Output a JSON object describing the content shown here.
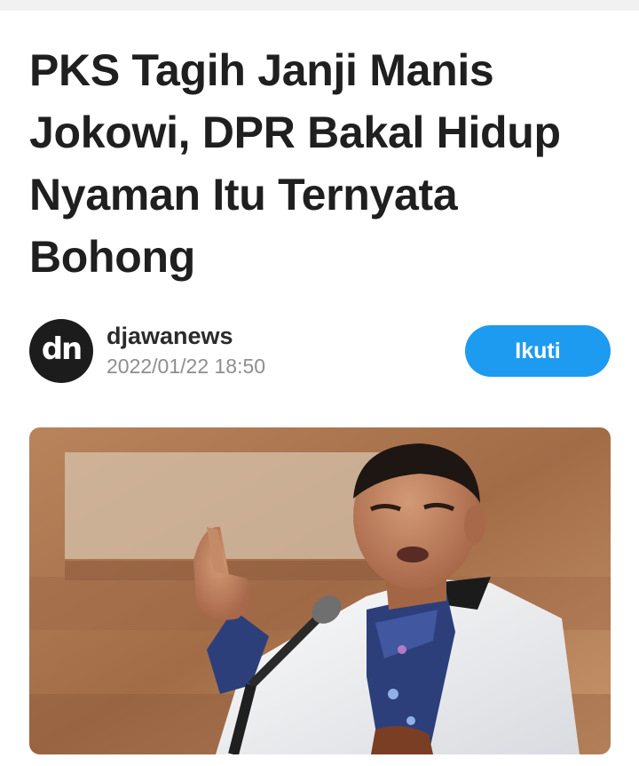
{
  "article": {
    "title": "PKS Tagih Janji Manis Jokowi, DPR Bakal Hidup Nyaman Itu Ternyata Bohong"
  },
  "author": {
    "avatar_initials": "dn",
    "name": "djawanews",
    "date": "2022/01/22 18:50",
    "follow_label": "Ikuti"
  },
  "colors": {
    "follow_button": "#1d9bf0",
    "title_text": "#1f1f1f",
    "meta_text": "#8e8e8e"
  },
  "image": {
    "icon": "speaker-photo"
  }
}
